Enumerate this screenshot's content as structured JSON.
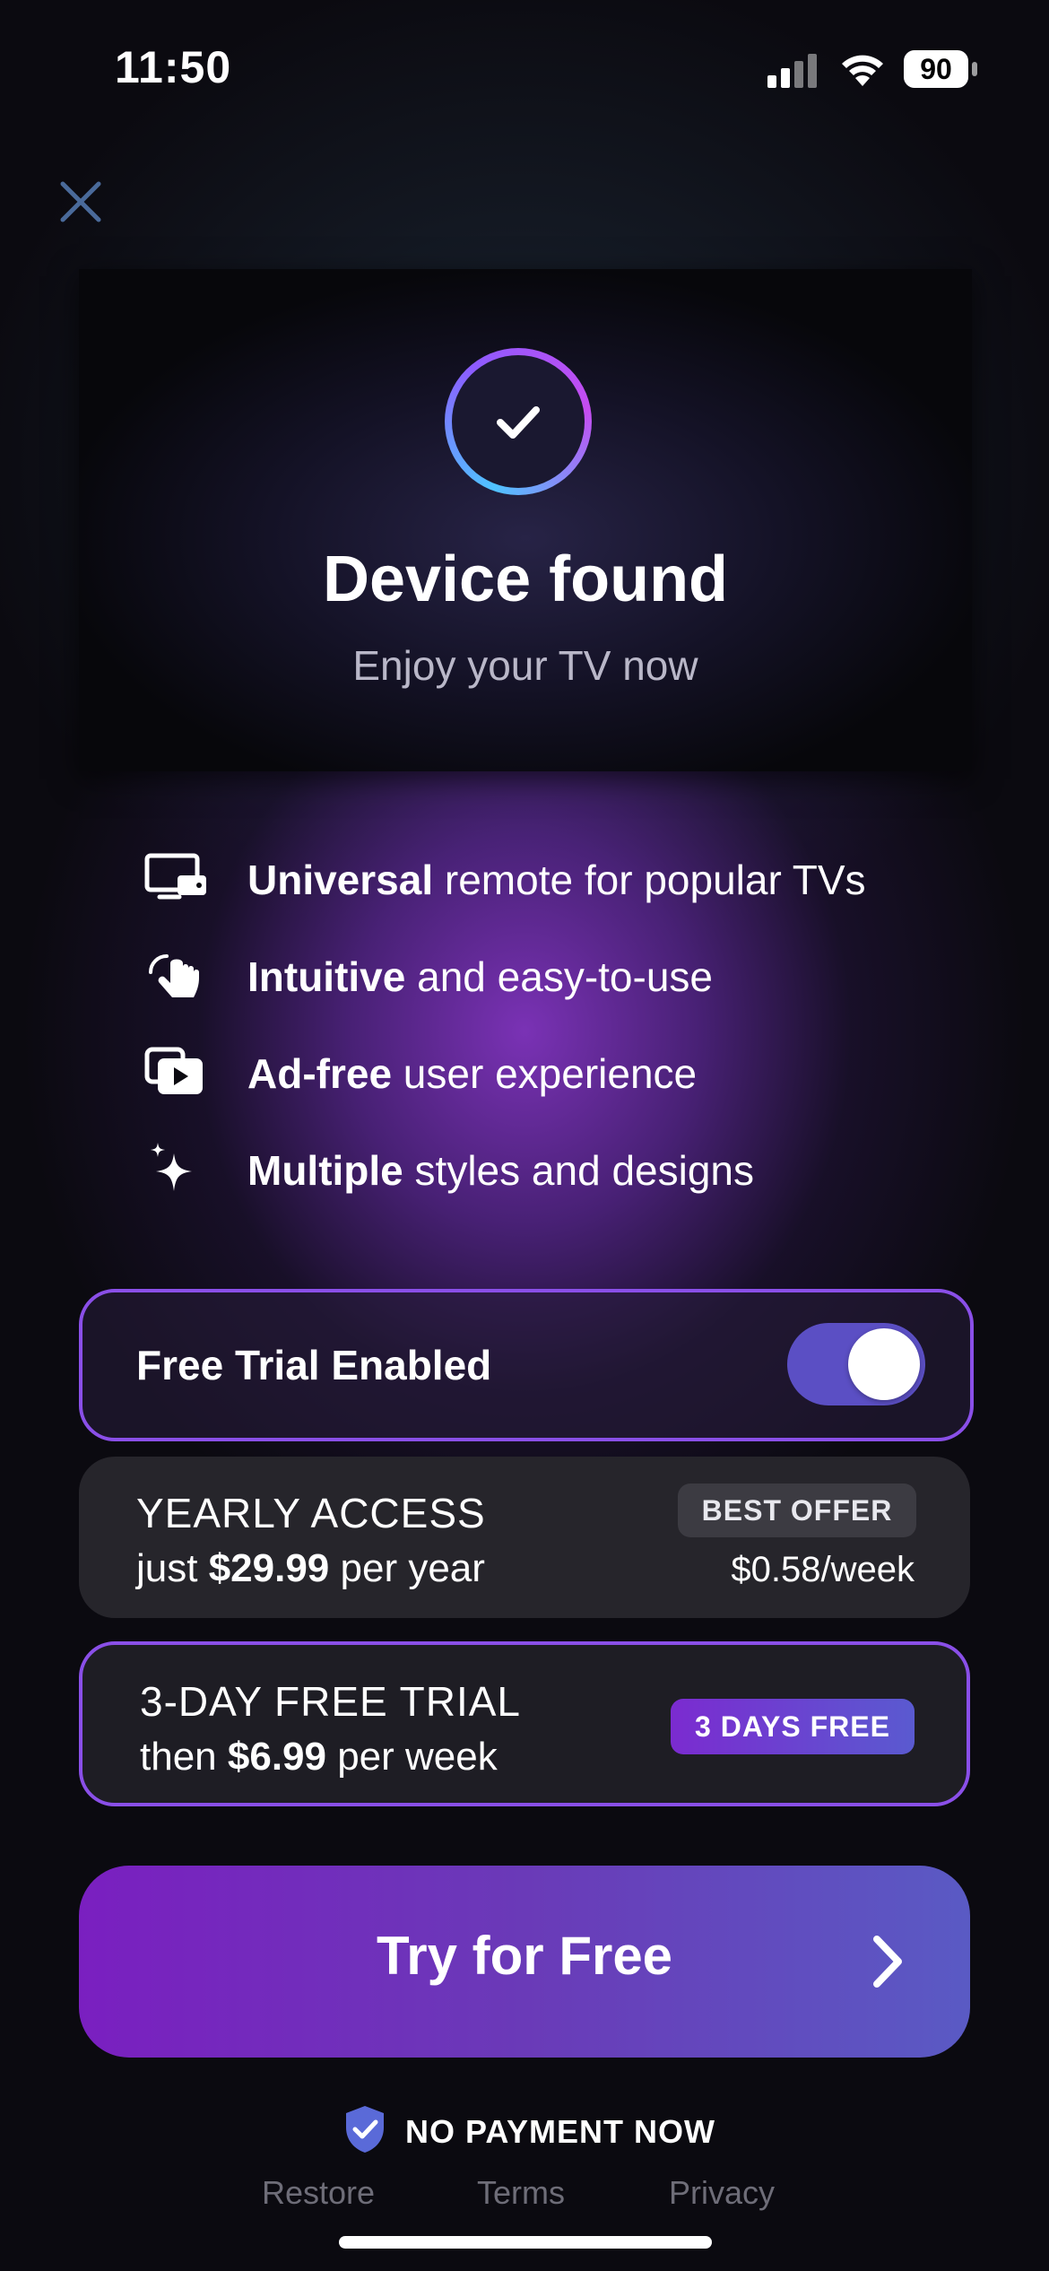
{
  "status_bar": {
    "time": "11:50",
    "battery": "90"
  },
  "hero": {
    "title": "Device found",
    "subtitle": "Enjoy your TV now"
  },
  "features": [
    {
      "icon": "tv-remote-icon",
      "bold": "Universal",
      "rest": " remote for popular TVs"
    },
    {
      "icon": "tap-hand-icon",
      "bold": "Intuitive",
      "rest": " and easy-to-use"
    },
    {
      "icon": "play-square-icon",
      "bold": "Ad-free",
      "rest": " user experience"
    },
    {
      "icon": "sparkles-icon",
      "bold": "Multiple",
      "rest": " styles and designs"
    }
  ],
  "free_trial_toggle": {
    "label": "Free Trial Enabled",
    "enabled": true
  },
  "plans": {
    "yearly": {
      "title": "YEARLY ACCESS",
      "price_prefix": "just ",
      "price": "$29.99",
      "price_suffix": " per year",
      "badge": "BEST OFFER",
      "per_week": "$0.58/week"
    },
    "trial": {
      "title": "3-DAY FREE TRIAL",
      "price_prefix": "then ",
      "price": "$6.99",
      "price_suffix": " per week",
      "badge": "3 DAYS FREE",
      "selected": true
    }
  },
  "cta": {
    "label": "Try for Free"
  },
  "no_payment": {
    "text": "NO PAYMENT NOW"
  },
  "footer": {
    "restore": "Restore",
    "terms": "Terms",
    "privacy": "Privacy"
  },
  "colors": {
    "accent": "#8a4fe8",
    "toggle_on": "#5b4fc4",
    "background": "#0b0a10"
  }
}
